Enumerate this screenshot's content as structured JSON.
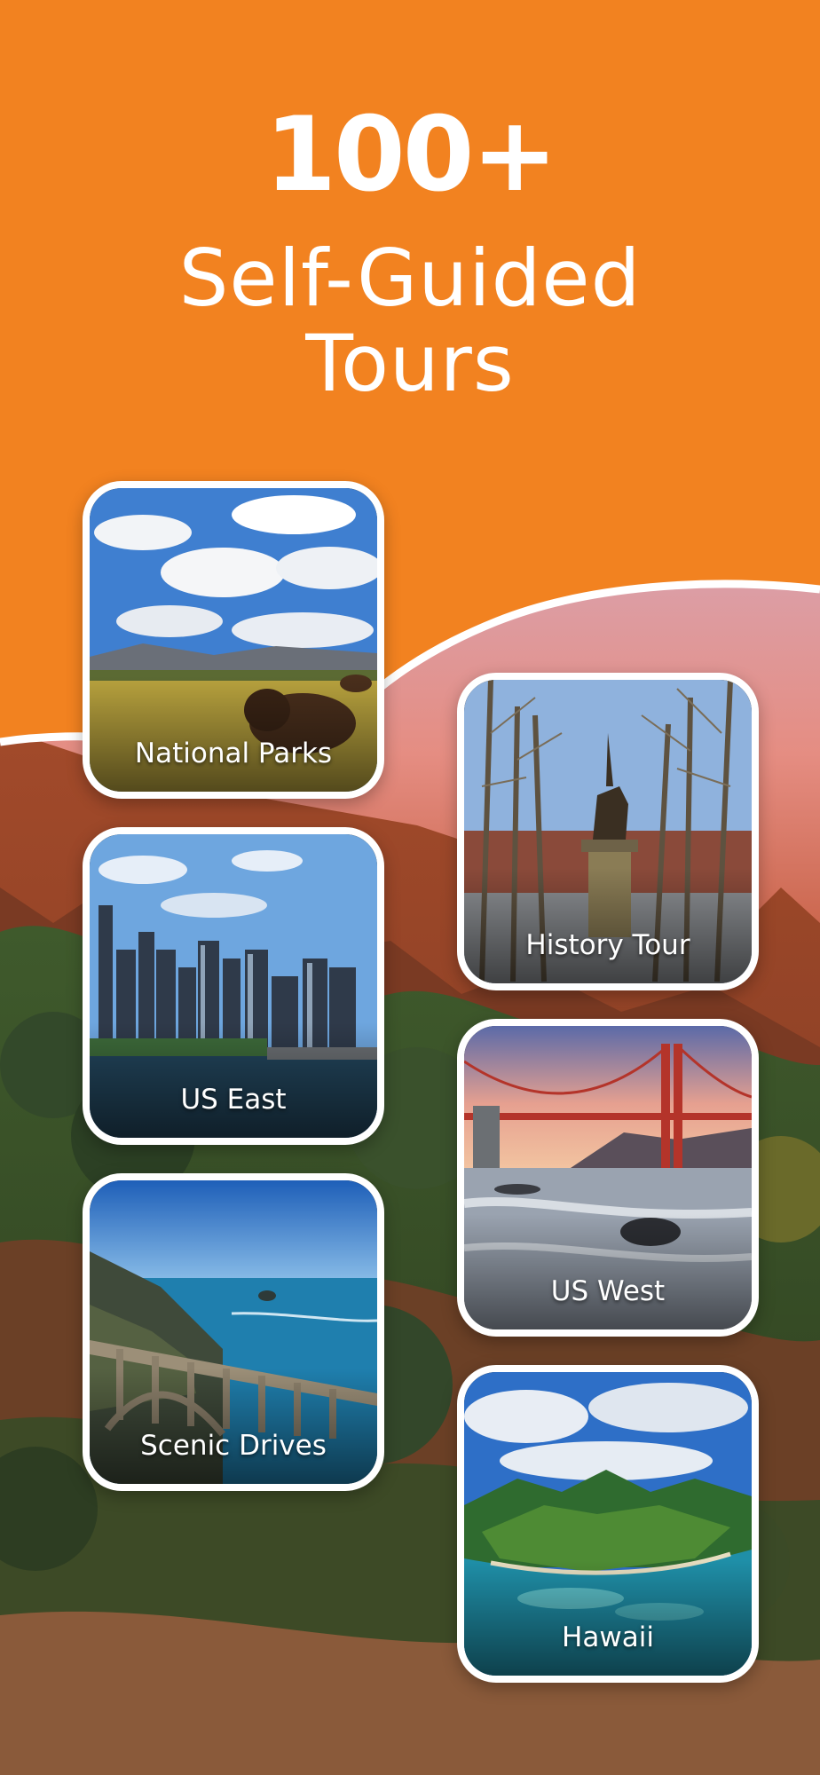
{
  "headline": {
    "count": "100+",
    "line1": "Self-Guided",
    "line2": "Tours"
  },
  "categories": [
    {
      "label": "National Parks",
      "icon": "bison-prairie-photo"
    },
    {
      "label": "History Tour",
      "icon": "statue-park-photo"
    },
    {
      "label": "US East",
      "icon": "city-skyline-photo"
    },
    {
      "label": "US West",
      "icon": "golden-gate-bridge-photo"
    },
    {
      "label": "Scenic Drives",
      "icon": "coastal-bridge-photo"
    },
    {
      "label": "Hawaii",
      "icon": "island-photo"
    }
  ],
  "colors": {
    "brand_orange": "#f28220",
    "card_border": "#ffffff",
    "text": "#ffffff"
  }
}
